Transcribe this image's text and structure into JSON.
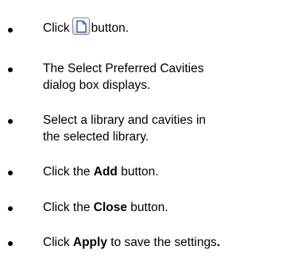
{
  "steps": [
    {
      "pre": "Click",
      "icon": "new-document-icon",
      "post": "button."
    },
    {
      "line1": "The Select Preferred Cavities",
      "line2": "dialog box displays."
    },
    {
      "line1": "Select a library and cavities in",
      "line2": "the selected library."
    },
    {
      "pre": "Click the ",
      "bold": "Add",
      "post": " button."
    },
    {
      "pre": "Click the ",
      "bold": "Close",
      "post": " button."
    },
    {
      "pre": "Click ",
      "bold": "Apply",
      "post": " to save the settings",
      "end_bold": "."
    }
  ],
  "colors": {
    "text": "#000000",
    "background": "#ffffff"
  }
}
